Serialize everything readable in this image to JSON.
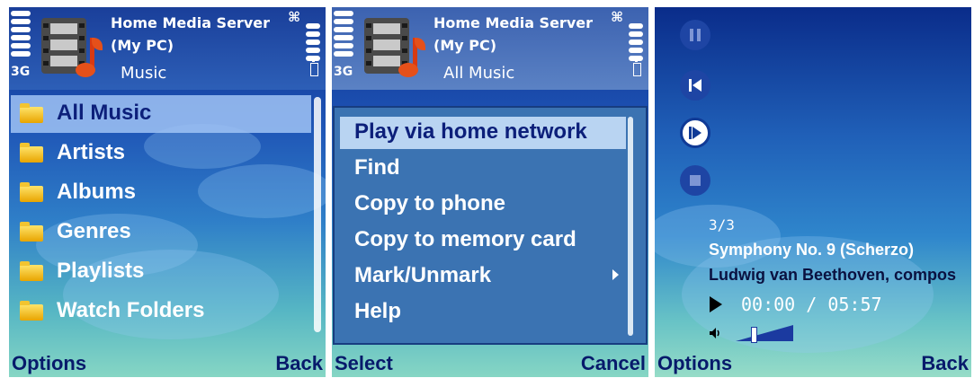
{
  "screen1": {
    "header": {
      "title_line1": "Home Media Server",
      "title_line2": "(My PC)",
      "subtitle": "Music",
      "network": "3G"
    },
    "items": [
      {
        "label": "All Music",
        "selected": true
      },
      {
        "label": "Artists"
      },
      {
        "label": "Albums"
      },
      {
        "label": "Genres"
      },
      {
        "label": "Playlists"
      },
      {
        "label": "Watch Folders"
      }
    ],
    "softkeys": {
      "left": "Options",
      "right": "Back"
    }
  },
  "screen2": {
    "header": {
      "title_line1": "Home Media Server",
      "title_line2": "(My PC)",
      "subtitle": "All Music",
      "network": "3G"
    },
    "menu": [
      {
        "label": "Play via home network",
        "selected": true
      },
      {
        "label": "Find"
      },
      {
        "label": "Copy to phone"
      },
      {
        "label": "Copy to memory card"
      },
      {
        "label": "Mark/Unmark",
        "submenu": true
      },
      {
        "label": "Help"
      }
    ],
    "softkeys": {
      "left": "Select",
      "right": "Cancel"
    }
  },
  "screen3": {
    "controls": [
      "pause-icon",
      "previous-icon",
      "next-icon",
      "stop-icon"
    ],
    "active_control": "next-icon",
    "track_counter": "3/3",
    "song_title": "Symphony No. 9 (Scherzo)",
    "artist": "Ludwig van Beethoven, compos",
    "time": "00:00 / 05:57",
    "volume_level": 0.3,
    "softkeys": {
      "left": "Options",
      "right": "Back"
    }
  }
}
